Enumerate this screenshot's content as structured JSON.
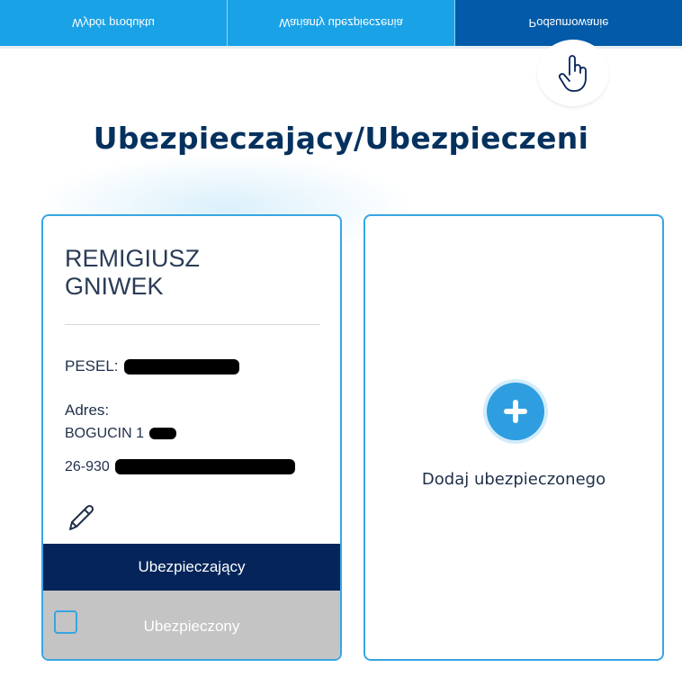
{
  "steps": [
    {
      "label": "Wybór produktu"
    },
    {
      "label": "Warianty ubezpieczenia"
    },
    {
      "label": "Podsumowanie"
    }
  ],
  "page_title": "Ubezpieczający/Ubezpieczeni",
  "person_card": {
    "first_name": "REMIGIUSZ",
    "last_name": "GNIWEK",
    "pesel_label": "PESEL:",
    "address_label": "Adres:",
    "address_line1": "BOGUCIN 1",
    "address_line2": "26-930",
    "role_active": "Ubezpieczający",
    "role_inactive": "Ubezpieczony"
  },
  "add_card": {
    "label": "Dodaj ubezpieczonego"
  },
  "icons": [
    "hand-pointer-icon",
    "pencil-icon",
    "plus-icon",
    "checkbox-icon"
  ],
  "colors": {
    "step_inactive": "#1aa2e7",
    "step_active": "#025aa8",
    "title": "#05315e",
    "card_border": "#37a6e3",
    "role_active_bg": "#04245a",
    "role_inactive_bg": "#c4c4c4",
    "accent": "#2f9ee0"
  }
}
